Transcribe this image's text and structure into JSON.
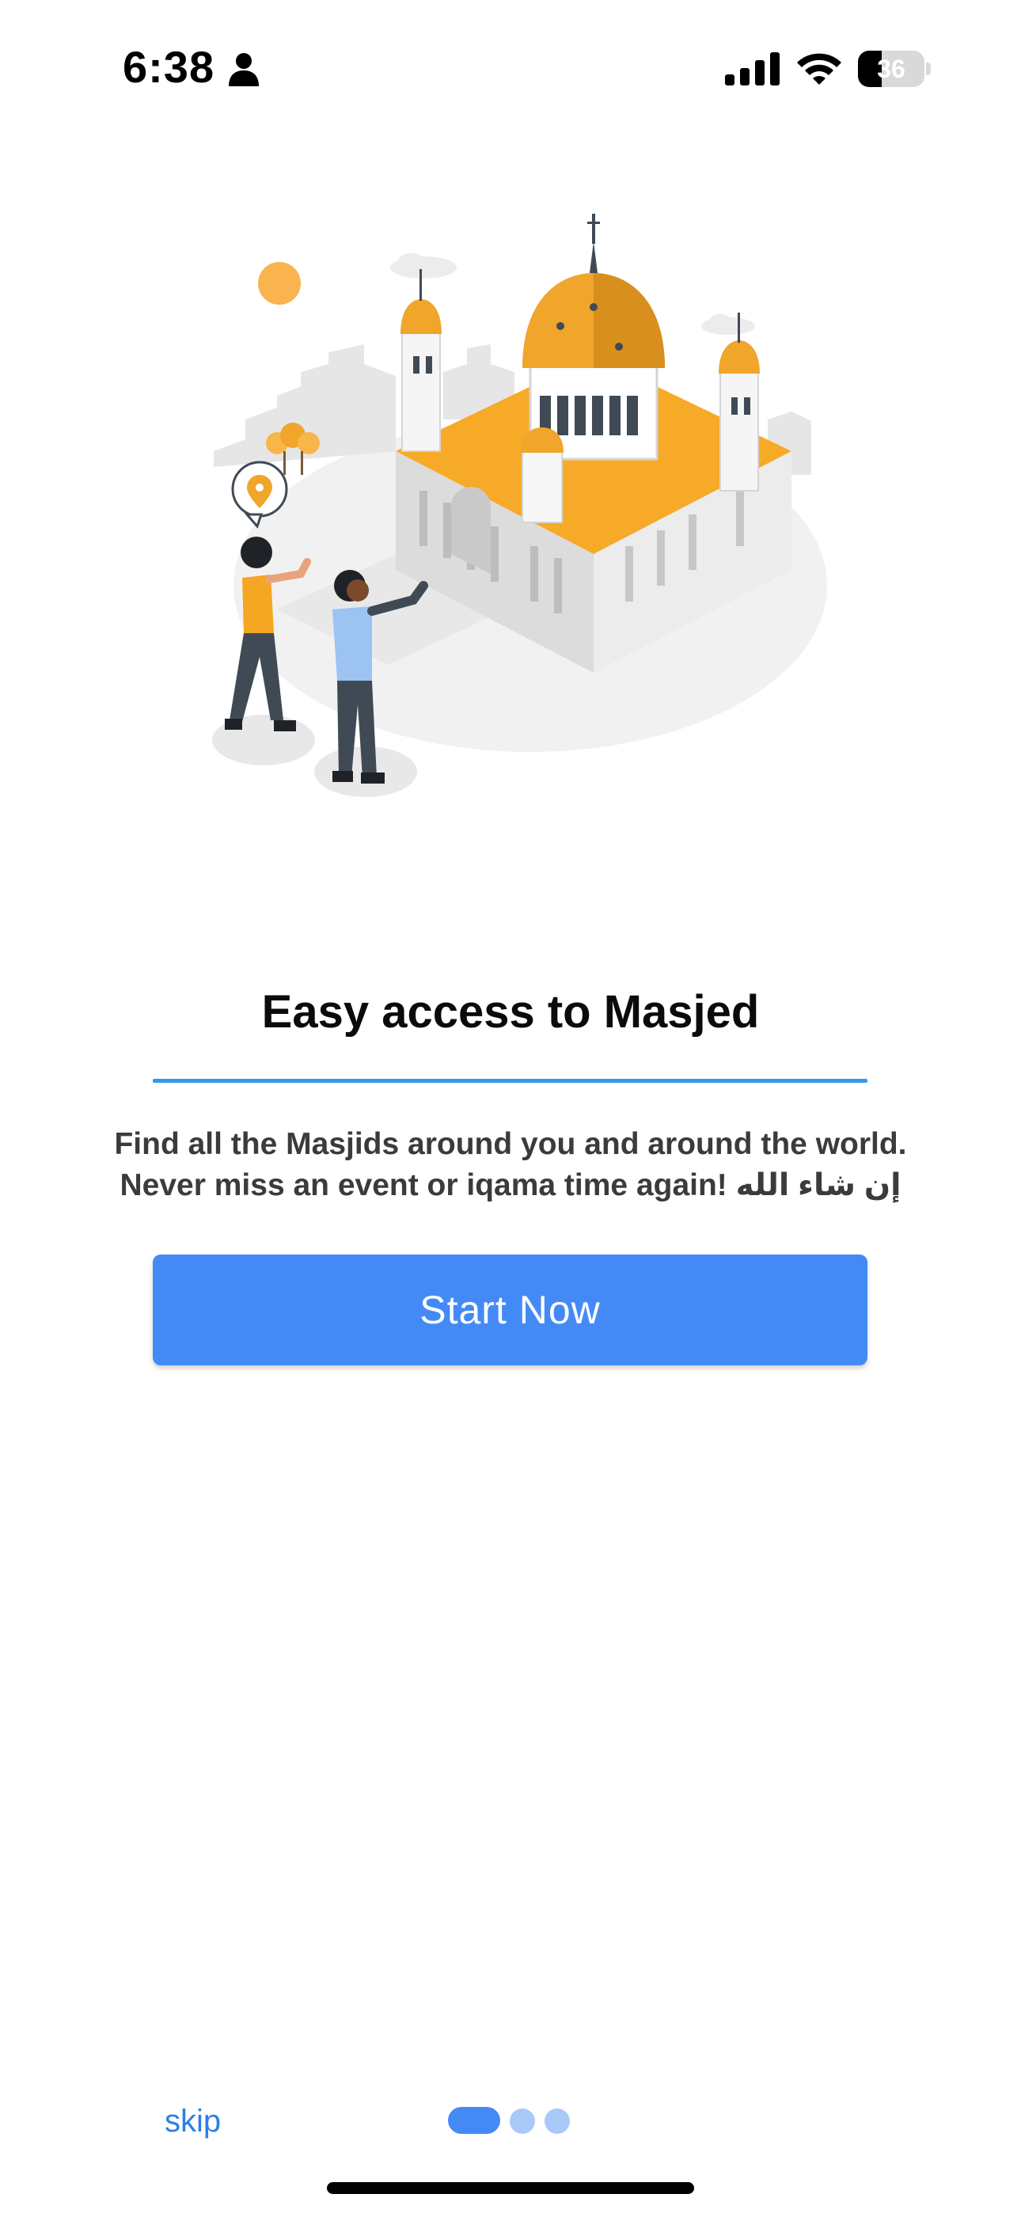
{
  "status_bar": {
    "time": "6:38",
    "battery_level": "36",
    "icons": [
      "person-icon",
      "signal-icon",
      "wifi-icon",
      "battery-icon"
    ]
  },
  "onboarding": {
    "title": "Easy access to Masjed",
    "description_line1": "Find all the Masjids around you and around the world.",
    "description_line2": "Never miss an event or iqama time again! إن شاء الله",
    "start_button_label": "Start Now",
    "skip_label": "skip",
    "page_count": 3,
    "current_page": 1
  },
  "colors": {
    "accent": "#448af7",
    "divider": "#3a97ec",
    "skip_text": "#2c7fe6",
    "dot_inactive": "#a9c9f8",
    "illustration_gold": "#f0a52b"
  }
}
